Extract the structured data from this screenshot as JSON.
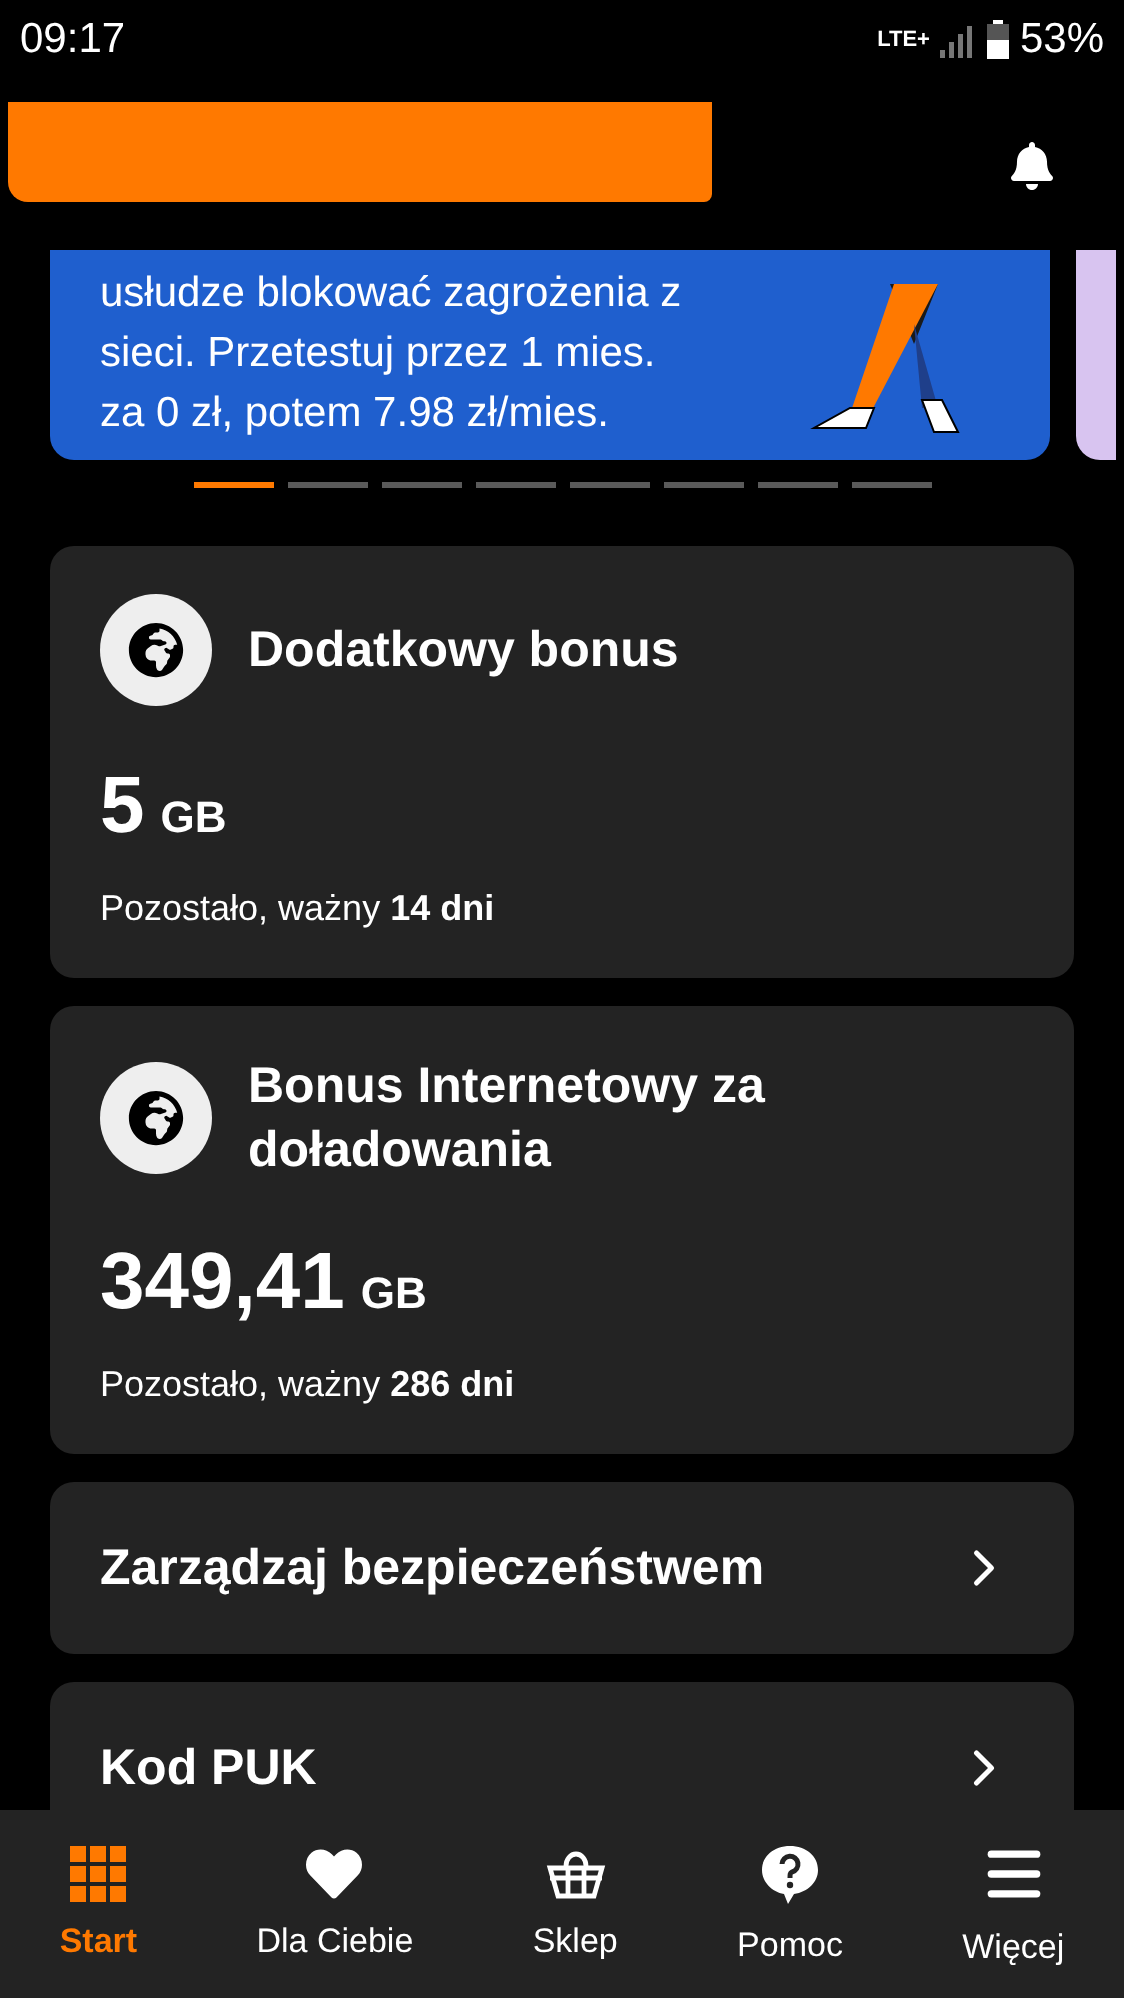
{
  "status_bar": {
    "time": "09:17",
    "network": "LTE+",
    "battery": "53%"
  },
  "banner": {
    "lines": [
      "usłudze blokować zagrożenia z",
      "sieci. Przetestuj przez 1 mies.",
      "za 0 zł, potem 7.98 zł/mies."
    ]
  },
  "carousel_dots": [
    {
      "selected": true
    },
    {
      "selected": false
    },
    {
      "selected": false
    },
    {
      "selected": false
    },
    {
      "selected": false
    },
    {
      "selected": false
    },
    {
      "selected": false
    },
    {
      "selected": false
    }
  ],
  "bonuses": [
    {
      "title": "Dodatkowy bonus",
      "amount": "5",
      "unit": "GB",
      "validity": "Pozostało, ważny **14 dni**"
    },
    {
      "title": "Bonus Internetowy za doładowania",
      "amount": "349,41",
      "unit": "GB",
      "validity": "Pozostało, ważny **286 dni**"
    }
  ],
  "links": [
    {
      "label": "Zarządzaj bezpieczeństwem"
    },
    {
      "label": "Kod PUK"
    }
  ],
  "nav": [
    {
      "label": "Start",
      "kind": "grid",
      "selected": true
    },
    {
      "label": "Dla Ciebie",
      "kind": "heart",
      "selected": false
    },
    {
      "label": "Sklep",
      "kind": "basket",
      "selected": false
    },
    {
      "label": "Pomoc",
      "kind": "help",
      "selected": false
    },
    {
      "label": "Więcej",
      "kind": "menu",
      "selected": false
    }
  ]
}
